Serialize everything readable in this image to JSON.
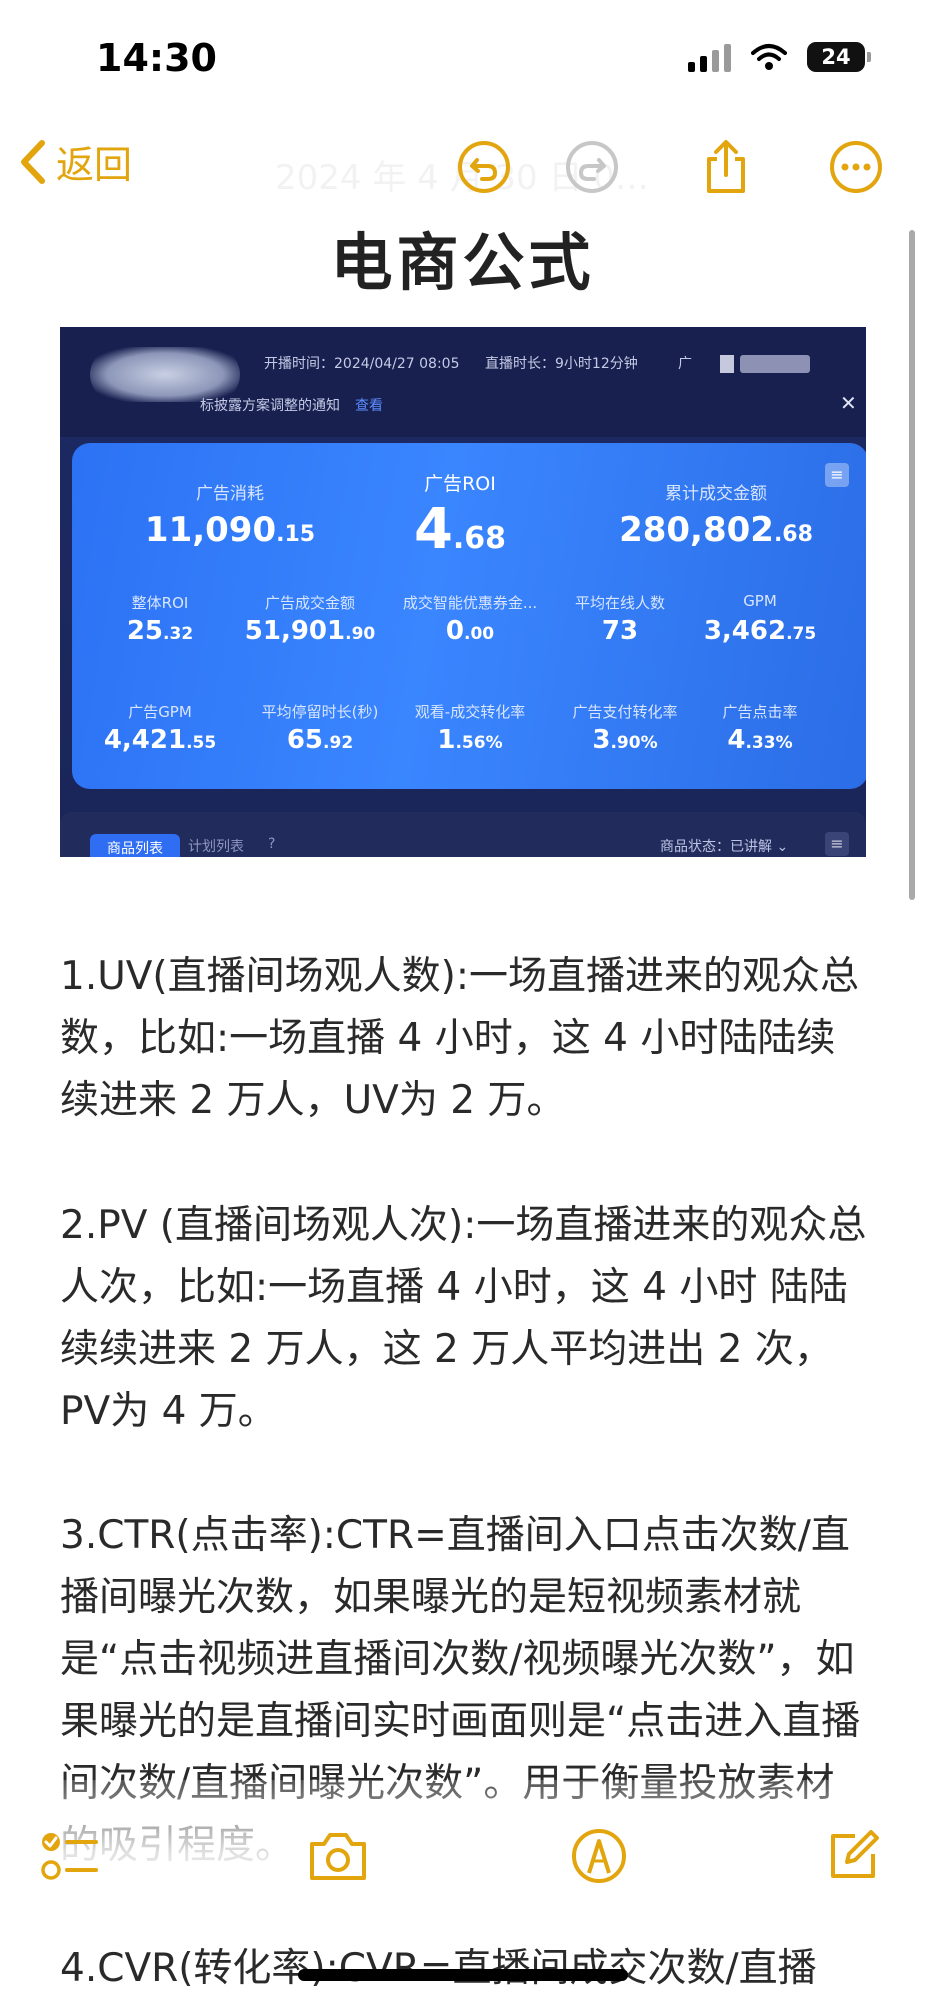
{
  "status_bar": {
    "time": "14:30",
    "battery": "24"
  },
  "toolbar": {
    "back_label": "返回",
    "ghost_date": "2024 年 4 月 30 日 0…"
  },
  "note": {
    "title": "电商公式",
    "paragraphs": [
      "1.UV(直播间场观人数):一场直播进来的观众总数，比如:一场直播 4 小时，这 4 小时陆陆续续进来 2 万人，UV为 2 万。",
      "2.PV (直播间场观人次):一场直播进来的观众总人次，比如:一场直播 4 小时，这 4 小时 陆陆续续进来 2 万人，这 2 万人平均进出 2 次，PV为 4 万。",
      "3.CTR(点击率):CTR=直播间入口点击次数/直播间曝光次数，如果曝光的是短视频素材就是“点击视频进直播间次数/视频曝光次数”，如果曝光的是直播间实时画面则是“点击进入直播间次数/直播间曝光次数”。用于衡量投放素材的吸引程度。",
      "4.CVR(转化率):CVR=直播间成交次数/直播"
    ]
  },
  "dashboard": {
    "start_time": "开播时间：2024/04/27 08:05",
    "duration": "直播时长：9小时12分钟",
    "ad_tag": "广",
    "notice": "标披露方案调整的通知",
    "notice_link": "查看",
    "close": "✕",
    "top_metrics": [
      {
        "label": "广告消耗",
        "value": "11,090",
        "decimal": ".15"
      },
      {
        "label": "广告ROI",
        "value": "4",
        "decimal": ".68"
      },
      {
        "label": "累计成交金额",
        "value": "280,802",
        "decimal": ".68"
      }
    ],
    "row2": [
      {
        "label": "整体ROI",
        "value": "25",
        "decimal": ".32"
      },
      {
        "label": "广告成交金额",
        "value": "51,901",
        "decimal": ".90"
      },
      {
        "label": "成交智能优惠券金...",
        "value": "0",
        "decimal": ".00"
      },
      {
        "label": "平均在线人数",
        "value": "73",
        "decimal": ""
      },
      {
        "label": "GPM",
        "value": "3,462",
        "decimal": ".75"
      }
    ],
    "row3": [
      {
        "label": "广告GPM",
        "value": "4,421",
        "decimal": ".55"
      },
      {
        "label": "平均停留时长(秒)",
        "value": "65",
        "decimal": ".92"
      },
      {
        "label": "观看-成交转化率",
        "value": "1",
        "decimal": ".56%"
      },
      {
        "label": "广告支付转化率",
        "value": "3",
        "decimal": ".90%"
      },
      {
        "label": "广告点击率",
        "value": "4",
        "decimal": ".33%"
      }
    ],
    "tab_active": "商品列表",
    "tab_other": "计划列表",
    "help": "?",
    "status_filter": "商品状态：已讲解 ⌄"
  },
  "colors": {
    "accent": "#e2a50d",
    "dash_blue": "#3a86ff",
    "dash_dark": "#1d2a64"
  },
  "icons": {
    "toolbar": [
      "chevron-left-icon",
      "undo-icon",
      "redo-icon",
      "share-icon",
      "more-icon"
    ],
    "bottom": [
      "checklist-icon",
      "camera-icon",
      "markup-pen-icon",
      "compose-icon"
    ]
  }
}
